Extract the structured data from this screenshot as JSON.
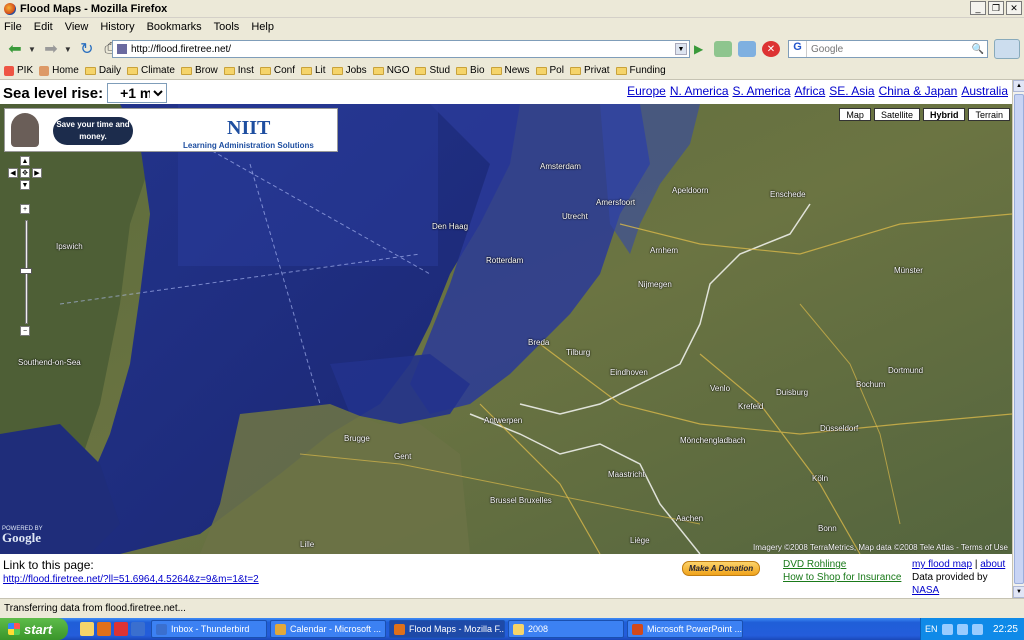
{
  "window": {
    "title": "Flood Maps - Mozilla Firefox",
    "min_label": "_",
    "max_label": "❐",
    "close_label": "✕"
  },
  "menu": [
    "File",
    "Edit",
    "View",
    "History",
    "Bookmarks",
    "Tools",
    "Help"
  ],
  "nav": {
    "url": "http://flood.firetree.net/",
    "search_engine_label": "G",
    "search_placeholder": "Google"
  },
  "bookmarks": [
    {
      "label": "PIK",
      "icon": "pik-icon"
    },
    {
      "label": "Home",
      "icon": "home-icon"
    },
    {
      "label": "Daily",
      "icon": "folder-icon"
    },
    {
      "label": "Climate",
      "icon": "folder-icon"
    },
    {
      "label": "Brow",
      "icon": "folder-icon"
    },
    {
      "label": "Inst",
      "icon": "folder-icon"
    },
    {
      "label": "Conf",
      "icon": "folder-icon"
    },
    {
      "label": "Lit",
      "icon": "folder-icon"
    },
    {
      "label": "Jobs",
      "icon": "folder-icon"
    },
    {
      "label": "NGO",
      "icon": "folder-icon"
    },
    {
      "label": "Stud",
      "icon": "folder-icon"
    },
    {
      "label": "Bio",
      "icon": "folder-icon"
    },
    {
      "label": "News",
      "icon": "folder-icon"
    },
    {
      "label": "Pol",
      "icon": "folder-icon"
    },
    {
      "label": "Privat",
      "icon": "folder-icon"
    },
    {
      "label": "Funding",
      "icon": "folder-icon"
    }
  ],
  "page": {
    "sea_level_label": "Sea level rise:",
    "sea_level_value": "+1 m",
    "regions": [
      "Europe",
      "N. America",
      "S. America",
      "Africa",
      "SE. Asia",
      "China & Japan",
      "Australia"
    ],
    "map_types": [
      "Map",
      "Satellite",
      "Hybrid",
      "Terrain"
    ],
    "map_type_selected": "Hybrid",
    "ad": {
      "bubble_text": "Save your time and money.",
      "brand": "NIIT",
      "tagline": "Learning Administration Solutions"
    },
    "google_powered": "POWERED BY",
    "google_logo": "Google",
    "copyright": "Imagery ©2008 TerraMetrics, Map data ©2008 Tele Atlas - Terms of Use",
    "city_labels": [
      "Amsterdam",
      "Den Haag",
      "Rotterdam",
      "Utrecht",
      "Amersfoort",
      "Apeldoorn",
      "Arnhem",
      "Nijmegen",
      "Eindhoven",
      "Antwerpen",
      "Brugge",
      "Gent",
      "Brussel Bruxelles",
      "Duisburg",
      "Düsseldorf",
      "Köln",
      "Dortmund",
      "Bochum",
      "Münster",
      "Enschede",
      "Ipswich",
      "Southend-on-Sea",
      "Tilburg",
      "Breda",
      "Venlo",
      "Krefeld",
      "Mönchengladbach",
      "Maastricht",
      "Aachen",
      "Liège",
      "Lille",
      "Bonn"
    ],
    "link_label": "Link to this page:",
    "link_url": "http://flood.firetree.net/?ll=51.6964,4.5264&z=9&m=1&t=2",
    "donate_label": "Make A Donation",
    "dvd_link": "DVD Rohlinge",
    "shop_link": "How to Shop for Insurance",
    "my_flood_map": "my flood map",
    "separator": "|",
    "about": "about",
    "data_provided_by": "Data provided by",
    "nasa": "NASA"
  },
  "status": "Transferring data from flood.firetree.net...",
  "taskbar": {
    "start": "start",
    "tasks": [
      {
        "label": "Inbox - Thunderbird",
        "color": "#3a6fcf"
      },
      {
        "label": "Calendar - Microsoft ...",
        "color": "#e2a83a"
      },
      {
        "label": "Flood Maps - Mozilla F...",
        "color": "#e0701a"
      },
      {
        "label": "2008",
        "color": "#f5d46a"
      },
      {
        "label": "Microsoft PowerPoint ...",
        "color": "#d2491b"
      }
    ],
    "active_task_index": 2,
    "lang": "EN",
    "clock": "22:25"
  },
  "colors": {
    "link_blue": "#0000cc",
    "flood_blue": "#1d2c7e",
    "land_green": "#586a42"
  }
}
